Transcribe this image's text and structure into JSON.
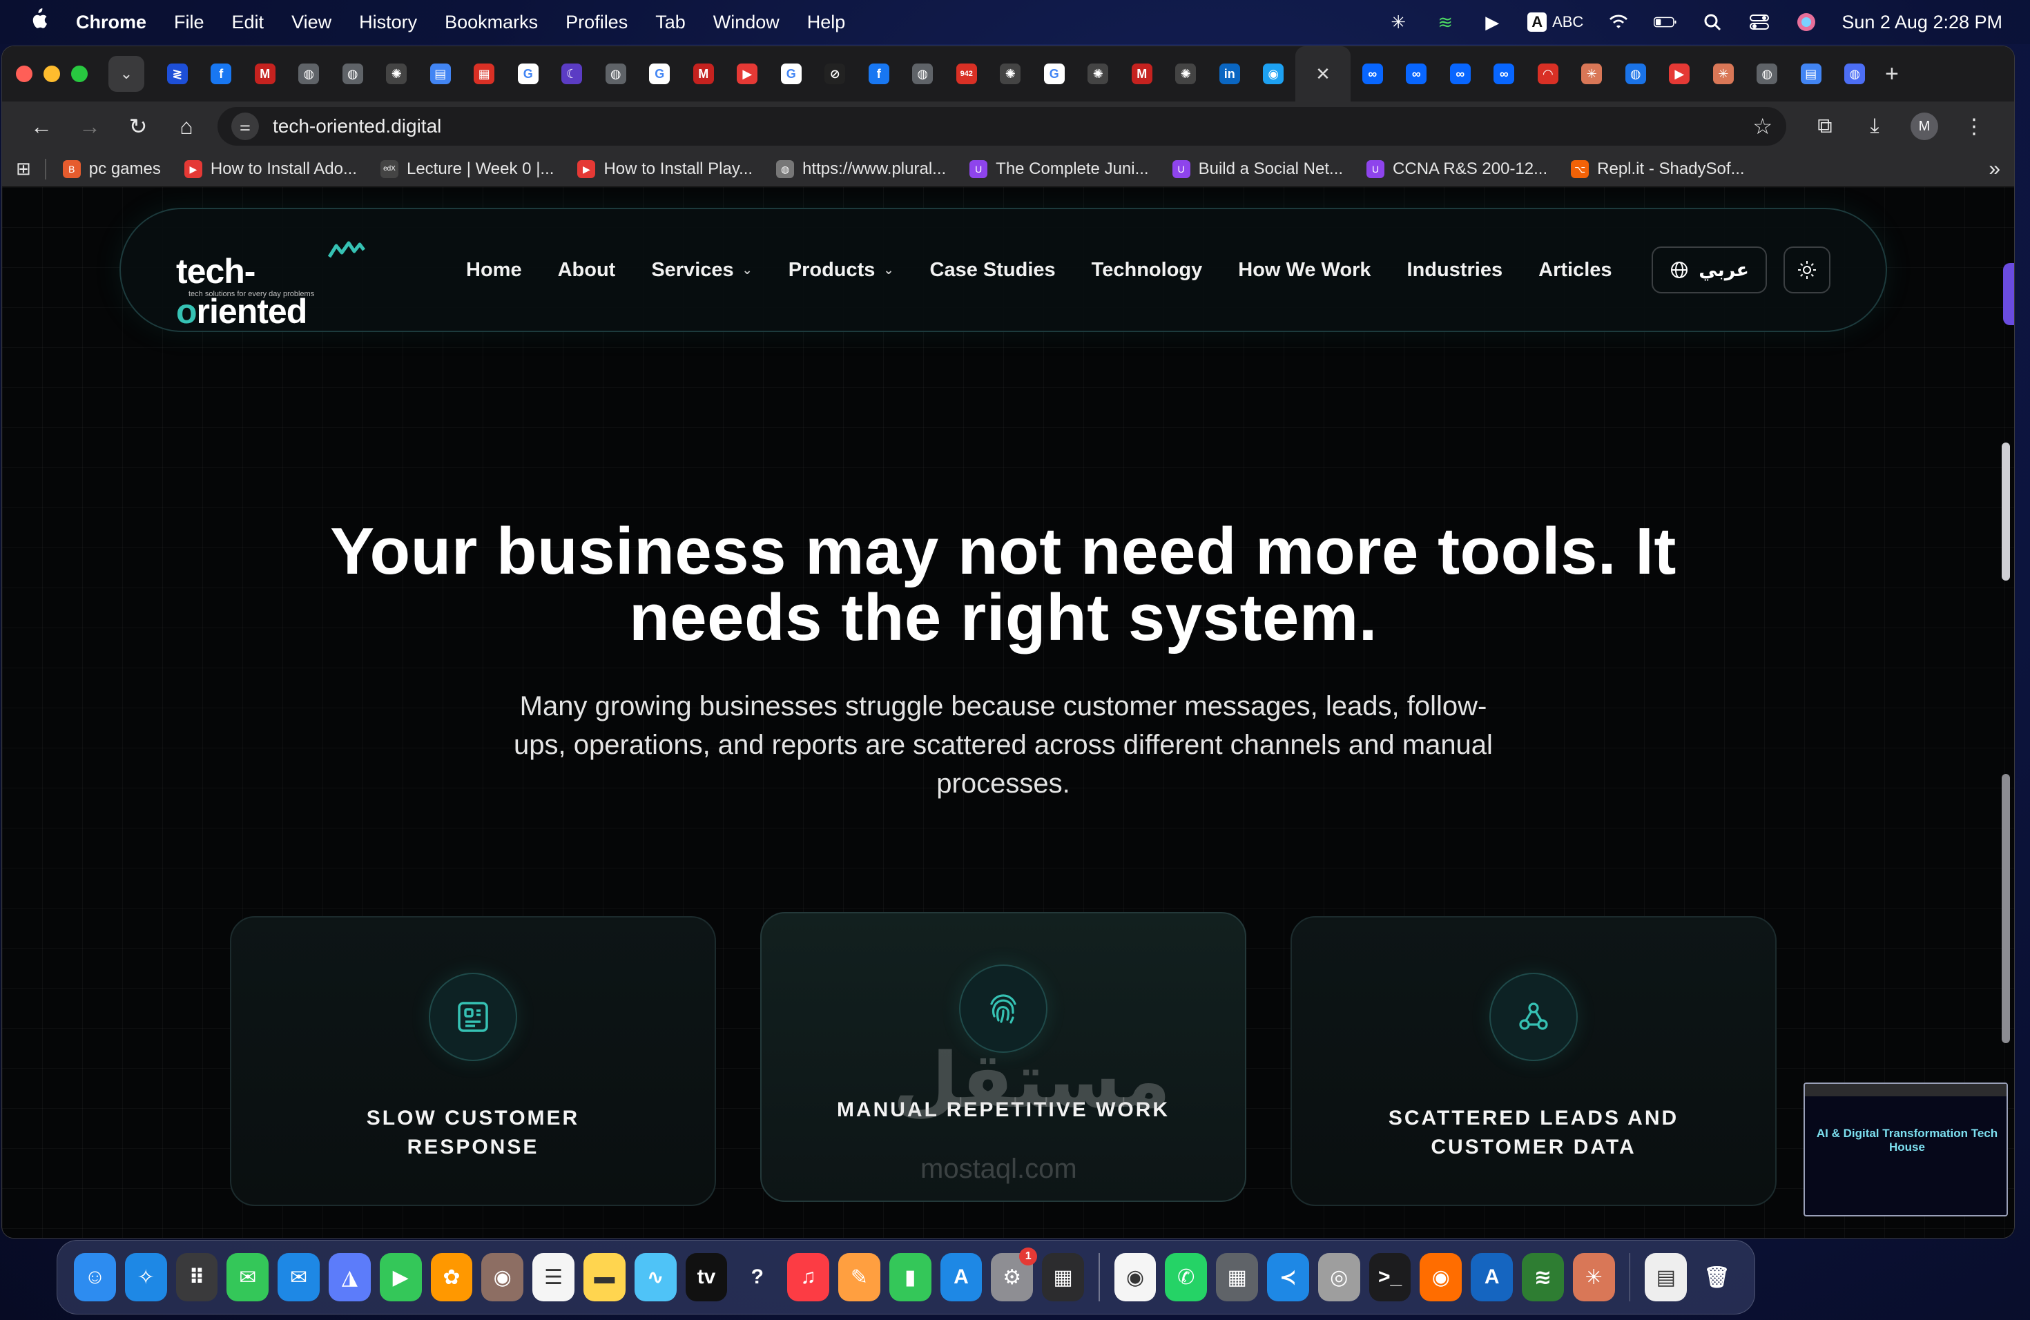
{
  "menubar": {
    "app_name": "Chrome",
    "items": [
      "File",
      "Edit",
      "View",
      "History",
      "Bookmarks",
      "Profiles",
      "Tab",
      "Window",
      "Help"
    ],
    "input_source": "ABC",
    "input_badge": "A",
    "datetime": "Sun 2 Aug  2:28 PM"
  },
  "browser": {
    "address": "tech-oriented.digital",
    "profile_initial": "M",
    "bookmarks": [
      {
        "label": "pc games",
        "color": "#e65c2e",
        "glyph": "B"
      },
      {
        "label": "How to Install Ado...",
        "color": "#e53935",
        "glyph": "▶"
      },
      {
        "label": "Lecture | Week 0 |...",
        "color": "#444444",
        "glyph": "edX"
      },
      {
        "label": "How to Install Play...",
        "color": "#e53935",
        "glyph": "▶"
      },
      {
        "label": "https://www.plural...",
        "color": "#777777",
        "glyph": "◍"
      },
      {
        "label": "The Complete Juni...",
        "color": "#8e44ec",
        "glyph": "U"
      },
      {
        "label": "Build a Social Net...",
        "color": "#8e44ec",
        "glyph": "U"
      },
      {
        "label": "CCNA R&S 200-12...",
        "color": "#8e44ec",
        "glyph": "U"
      },
      {
        "label": "Repl.it - ShadySof...",
        "color": "#f26207",
        "glyph": "⌥"
      }
    ],
    "tabs": [
      {
        "glyph": "≷",
        "color": "#1d4fd8"
      },
      {
        "glyph": "f",
        "color": "#1877f2"
      },
      {
        "glyph": "M",
        "color": "#c5221f"
      },
      {
        "glyph": "◍",
        "color": "#5f6368"
      },
      {
        "glyph": "◍",
        "color": "#5f6368"
      },
      {
        "glyph": "✺",
        "color": "#444444"
      },
      {
        "glyph": "▤",
        "color": "#4285f4"
      },
      {
        "glyph": "▦",
        "color": "#d93025"
      },
      {
        "glyph": "G",
        "color": "#ffffff"
      },
      {
        "glyph": "☾",
        "color": "#5b3cc4"
      },
      {
        "glyph": "◍",
        "color": "#5f6368"
      },
      {
        "glyph": "G",
        "color": "#ffffff"
      },
      {
        "glyph": "M",
        "color": "#c5221f"
      },
      {
        "glyph": "▶",
        "color": "#e53935"
      },
      {
        "glyph": "G",
        "color": "#ffffff"
      },
      {
        "glyph": "⊘",
        "color": "#222222"
      },
      {
        "glyph": "f",
        "color": "#1877f2"
      },
      {
        "glyph": "◍",
        "color": "#5f6368"
      },
      {
        "glyph": "942",
        "color": "#d93025"
      },
      {
        "glyph": "✺",
        "color": "#444444"
      },
      {
        "glyph": "G",
        "color": "#ffffff"
      },
      {
        "glyph": "✺",
        "color": "#444444"
      },
      {
        "glyph": "M",
        "color": "#c5221f"
      },
      {
        "glyph": "✺",
        "color": "#444444"
      },
      {
        "glyph": "in",
        "color": "#0a66c2"
      },
      {
        "glyph": "◉",
        "color": "#1da1f2"
      }
    ],
    "tabs_after": [
      {
        "glyph": "∞",
        "color": "#0866ff"
      },
      {
        "glyph": "∞",
        "color": "#0866ff"
      },
      {
        "glyph": "∞",
        "color": "#0866ff"
      },
      {
        "glyph": "∞",
        "color": "#0866ff"
      },
      {
        "glyph": "◠",
        "color": "#d93025"
      },
      {
        "glyph": "✳",
        "color": "#d97757"
      },
      {
        "glyph": "◍",
        "color": "#1a73e8"
      },
      {
        "glyph": "▶",
        "color": "#e53935"
      },
      {
        "glyph": "✳",
        "color": "#d97757"
      },
      {
        "glyph": "◍",
        "color": "#5f6368"
      },
      {
        "glyph": "▤",
        "color": "#4285f4"
      },
      {
        "glyph": "◍",
        "color": "#4c6ef5"
      }
    ]
  },
  "site": {
    "logo_prefix": "tech-",
    "logo_highlight": "o",
    "logo_suffix": "riented",
    "logo_tagline": "tech solutions for every day problems",
    "nav": [
      {
        "label": "Home",
        "dropdown": false
      },
      {
        "label": "About",
        "dropdown": false
      },
      {
        "label": "Services",
        "dropdown": true
      },
      {
        "label": "Products",
        "dropdown": true
      },
      {
        "label": "Case Studies",
        "dropdown": false
      },
      {
        "label": "Technology",
        "dropdown": false
      },
      {
        "label": "How We Work",
        "dropdown": false
      },
      {
        "label": "Industries",
        "dropdown": false
      },
      {
        "label": "Articles",
        "dropdown": false
      }
    ],
    "language_label": "عربي",
    "hero_title_line1": "Your business may not need more tools. It",
    "hero_title_line2": "needs the right system.",
    "hero_subtitle_line1": "Many growing businesses struggle because customer messages, leads, follow-",
    "hero_subtitle_line2": "ups, operations, and reports are scattered across different channels and manual",
    "hero_subtitle_line3": "processes.",
    "cards": [
      {
        "title": "SLOW CUSTOMER RESPONSE",
        "icon": "dashboard-icon"
      },
      {
        "title": "MANUAL REPETITIVE WORK",
        "icon": "fingerprint-icon"
      },
      {
        "title": "SCATTERED LEADS AND CUSTOMER DATA",
        "icon": "webhook-icon"
      }
    ],
    "watermark": "مستقل",
    "watermark_sub": "mostaql.com",
    "thumbnail_title": "AI & Digital Transformation Tech House"
  },
  "accent_color": "#36c2b4",
  "dock": [
    {
      "name": "finder",
      "color": "#2d8cf0",
      "glyph": "☺"
    },
    {
      "name": "safari",
      "color": "#1e88e5",
      "glyph": "✧"
    },
    {
      "name": "launchpad",
      "color": "#3a3a3c",
      "glyph": "⠿"
    },
    {
      "name": "messages",
      "color": "#34c759",
      "glyph": "✉"
    },
    {
      "name": "mail",
      "color": "#1e88e5",
      "glyph": "✉"
    },
    {
      "name": "maps",
      "color": "#5c7cfa",
      "glyph": "◮"
    },
    {
      "name": "facetime",
      "color": "#34c759",
      "glyph": "▶"
    },
    {
      "name": "photos",
      "color": "#ff9800",
      "glyph": "✿"
    },
    {
      "name": "contacts",
      "color": "#8d6e63",
      "glyph": "◉"
    },
    {
      "name": "reminders",
      "color": "#f5f5f5",
      "glyph": "☰"
    },
    {
      "name": "notes",
      "color": "#ffd54f",
      "glyph": "▬"
    },
    {
      "name": "freeform",
      "color": "#4fc3f7",
      "glyph": "∿"
    },
    {
      "name": "tv",
      "color": "#111111",
      "glyph": "tv"
    },
    {
      "name": "help",
      "color": "transparent",
      "glyph": "?"
    },
    {
      "name": "music",
      "color": "#fc3c44",
      "glyph": "♫"
    },
    {
      "name": "pages",
      "color": "#ff9f40",
      "glyph": "✎"
    },
    {
      "name": "numbers",
      "color": "#34c759",
      "glyph": "▮"
    },
    {
      "name": "app-store",
      "color": "#1e88e5",
      "glyph": "A"
    },
    {
      "name": "system-settings",
      "color": "#8e8e93",
      "glyph": "⚙",
      "badge": "1"
    },
    {
      "name": "screen",
      "color": "#2c2c2e",
      "glyph": "▦"
    },
    {
      "name": "chrome",
      "color": "#f5f5f5",
      "glyph": "◉"
    },
    {
      "name": "whatsapp",
      "color": "#25d366",
      "glyph": "✆"
    },
    {
      "name": "calculator",
      "color": "#5f6368",
      "glyph": "▦"
    },
    {
      "name": "vscode",
      "color": "#1e88e5",
      "glyph": "≺"
    },
    {
      "name": "disk-utility",
      "color": "#9e9e9e",
      "glyph": "◎"
    },
    {
      "name": "terminal",
      "color": "#1c1c1e",
      "glyph": ">_"
    },
    {
      "name": "recorder",
      "color": "#ff6d00",
      "glyph": "◉"
    },
    {
      "name": "arc",
      "color": "#1565c0",
      "glyph": "A"
    },
    {
      "name": "waveform",
      "color": "#2e7d32",
      "glyph": "≋"
    },
    {
      "name": "claude",
      "color": "#d97757",
      "glyph": "✳"
    },
    {
      "name": "documents",
      "color": "#eeeeee",
      "glyph": "▤"
    },
    {
      "name": "trash",
      "color": "transparent",
      "glyph": "🗑"
    }
  ]
}
